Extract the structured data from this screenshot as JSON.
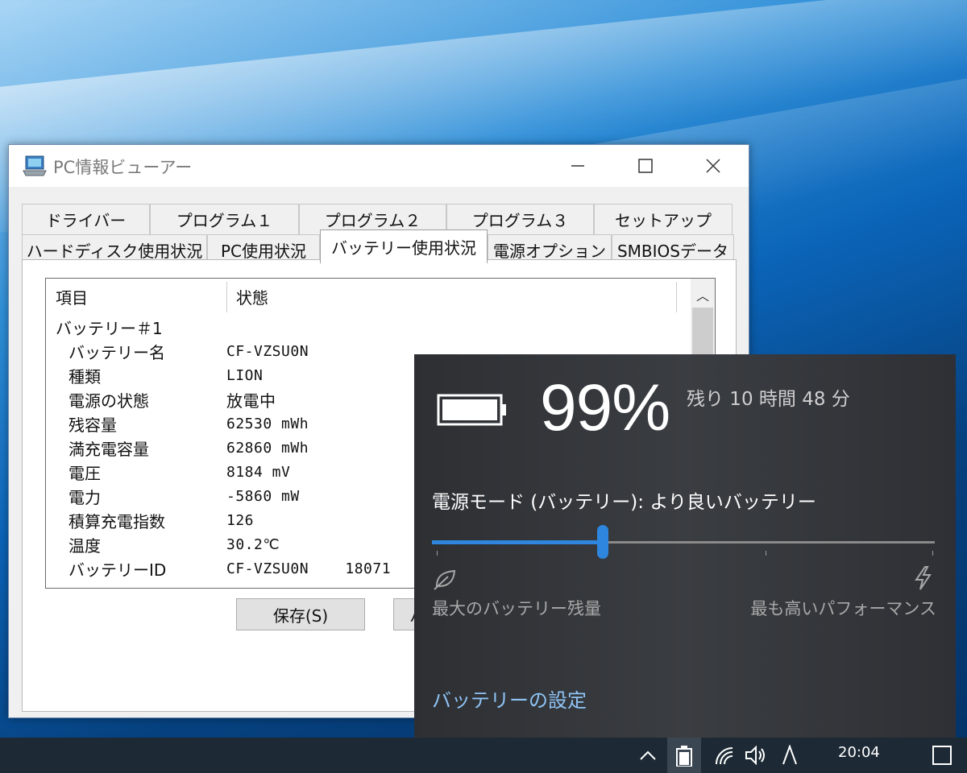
{
  "window": {
    "title": "PC情報ビューアー",
    "tabs_row1": [
      "ドライバー",
      "プログラム１",
      "プログラム２",
      "プログラム３",
      "セットアップ"
    ],
    "tabs_row2": [
      "ハードディスク使用状況",
      "PC使用状況",
      "バッテリー使用状況",
      "電源オプション",
      "SMBIOSデータ"
    ],
    "active_tab": "バッテリー使用状況",
    "list": {
      "col_item": "項目",
      "col_status": "状態",
      "rows": [
        {
          "k": "バッテリー＃1",
          "v": ""
        },
        {
          "k": "バッテリー名",
          "v": "CF-VZSU0N"
        },
        {
          "k": "種類",
          "v": "LION"
        },
        {
          "k": "電源の状態",
          "v": "放電中"
        },
        {
          "k": "残容量",
          "v": "62530 mWh"
        },
        {
          "k": "満充電容量",
          "v": "62860 mWh"
        },
        {
          "k": "電圧",
          "v": "8184 mV"
        },
        {
          "k": "電力",
          "v": "-5860 mW"
        },
        {
          "k": "積算充電指数",
          "v": "126"
        },
        {
          "k": "温度",
          "v": "30.2℃"
        },
        {
          "k": "バッテリーID",
          "v": "CF-VZSU0N    18071"
        }
      ]
    },
    "save_button": "保存(S)",
    "second_button": "ハ"
  },
  "flyout": {
    "percent": "99%",
    "remaining": "残り 10 時間 48 分",
    "mode_label": "電源モード (バッテリー): より良いバッテリー",
    "slider_level": 0.34,
    "left_label": "最大のバッテリー残量",
    "right_label": "最も高いパフォーマンス",
    "settings_link": "バッテリーの設定",
    "accent": "#2e86de"
  },
  "taskbar": {
    "time": "20:04"
  }
}
